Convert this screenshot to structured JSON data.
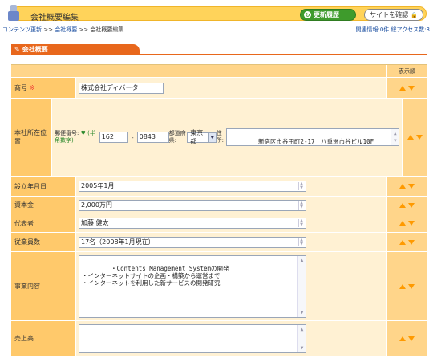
{
  "header": {
    "title": "会社概要編集",
    "history_button": "更新履歴",
    "site_button": "サイトを確認"
  },
  "breadcrumb": {
    "items": [
      "コンテンツ更新",
      "会社概要",
      "会社概要編集"
    ],
    "separator": ">>"
  },
  "stats": {
    "text": "関連情報:0件  総アクセス数:3"
  },
  "section": {
    "title": "会社概要"
  },
  "table": {
    "order_header": "表示順",
    "rows": {
      "company_name": {
        "label": "商号",
        "required_mark": "※",
        "value": "株式会社ディバータ"
      },
      "address": {
        "label": "本社所在位置",
        "zip_label": "郵便番号:",
        "zip_hint": "(半角数字)",
        "zip1": "162",
        "zip_dash": "-",
        "zip2": "0843",
        "pref_label": "都道府県:",
        "pref_value": "東京都",
        "addr_label": "住所:",
        "addr_value": "新宿区市谷田町2-17　八重洲市谷ビル10F"
      },
      "founded": {
        "label": "設立年月日",
        "value": "2005年1月"
      },
      "capital": {
        "label": "資本金",
        "value": "2,000万円"
      },
      "representative": {
        "label": "代表者",
        "value": "加藤 健太"
      },
      "employees": {
        "label": "従業員数",
        "value": "17名（2008年1月現在）"
      },
      "business": {
        "label": "事業内容",
        "value": "・Contents Management Systemの開発\n・インターネットサイトの企画・構築から運営まで\n・インターネットを利用した新サービスの開発研究"
      },
      "sales": {
        "label": "売上高",
        "value": ""
      }
    }
  },
  "colors": {
    "header_bg": "#ffd35a",
    "accent_orange": "#e8671c",
    "label_bg": "#ffc96b",
    "cell_bg": "#fff1d3",
    "history_button": "#3e9b2c",
    "arrow": "#ff9a00"
  },
  "icons": [
    "user-icon",
    "refresh-icon",
    "lock-icon",
    "pencil-icon",
    "arrow-up-icon",
    "arrow-down-icon",
    "dropdown-caret-icon"
  ]
}
